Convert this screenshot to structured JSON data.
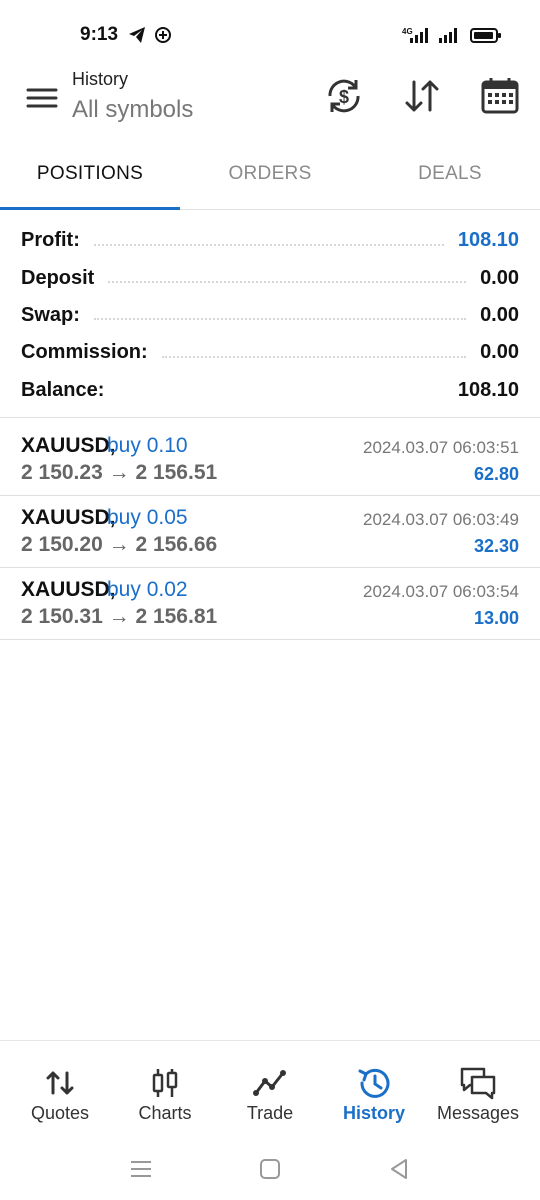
{
  "status_bar": {
    "time": "9:13",
    "left_icons": [
      "telegram-icon",
      "sync-plus-icon"
    ],
    "right_icons": [
      "4g-signal-icon",
      "signal-icon",
      "battery-icon"
    ],
    "network": "4G"
  },
  "header": {
    "title": "History",
    "subtitle": "All symbols",
    "icons": [
      "menu-icon",
      "currency-exchange-icon",
      "sort-icon",
      "calendar-icon"
    ]
  },
  "tabs": [
    {
      "label": "POSITIONS",
      "active": true
    },
    {
      "label": "ORDERS",
      "active": false
    },
    {
      "label": "DEALS",
      "active": false
    }
  ],
  "summary": [
    {
      "label": "Profit:",
      "value": "108.10",
      "highlight": true
    },
    {
      "label": "Deposit",
      "value": "0.00",
      "highlight": false
    },
    {
      "label": "Swap:",
      "value": "0.00",
      "highlight": false
    },
    {
      "label": "Commission:",
      "value": "0.00",
      "highlight": false
    },
    {
      "label": "Balance:",
      "value": "108.10",
      "highlight": false
    }
  ],
  "positions": [
    {
      "symbol": "XAUUSD,",
      "side": "buy 0.10",
      "open_price": "2 150.23",
      "close_price": "2 156.51",
      "time": "2024.03.07 06:03:51",
      "profit": "62.80"
    },
    {
      "symbol": "XAUUSD,",
      "side": "buy 0.05",
      "open_price": "2 150.20",
      "close_price": "2 156.66",
      "time": "2024.03.07 06:03:49",
      "profit": "32.30"
    },
    {
      "symbol": "XAUUSD,",
      "side": "buy 0.02",
      "open_price": "2 150.31",
      "close_price": "2 156.81",
      "time": "2024.03.07 06:03:54",
      "profit": "13.00"
    }
  ],
  "arrow": "→",
  "bottom_nav": [
    {
      "label": "Quotes",
      "icon": "quotes-icon",
      "active": false
    },
    {
      "label": "Charts",
      "icon": "charts-icon",
      "active": false
    },
    {
      "label": "Trade",
      "icon": "trade-icon",
      "active": false
    },
    {
      "label": "History",
      "icon": "history-icon",
      "active": true
    },
    {
      "label": "Messages",
      "icon": "messages-icon",
      "active": false
    }
  ],
  "system_nav": [
    "recents-icon",
    "home-icon",
    "back-icon"
  ],
  "colors": {
    "accent": "#1a6fc9",
    "text": "#111111",
    "muted": "#777777"
  }
}
